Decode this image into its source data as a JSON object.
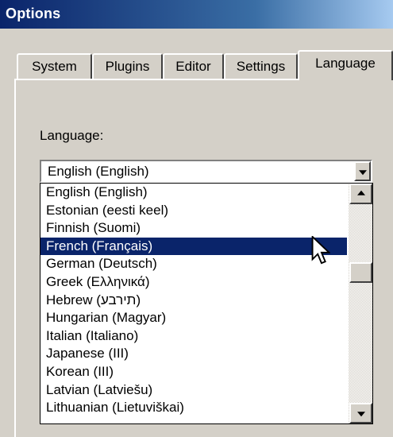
{
  "window": {
    "title": "Options"
  },
  "tabs": [
    {
      "label": "System",
      "active": false
    },
    {
      "label": "Plugins",
      "active": false
    },
    {
      "label": "Editor",
      "active": false
    },
    {
      "label": "Settings",
      "active": false
    },
    {
      "label": "Language",
      "active": true
    }
  ],
  "language": {
    "label": "Language:",
    "selected_value": "English (English)",
    "options": [
      "English (English)",
      "Estonian (eesti keel)",
      "Finnish (Suomi)",
      "French (Français)",
      "German (Deutsch)",
      "Greek  (Ελληνικά)",
      "Hebrew (תירבע)",
      "Hungarian (Magyar)",
      "Italian (Italiano)",
      "Japanese (III)",
      "Korean (III)",
      "Latvian (Latviešu)",
      "Lithuanian (Lietuviškai)"
    ],
    "highlighted_index": 3
  },
  "colors": {
    "title_bar": "#0a246a",
    "highlight": "#0a246a",
    "face": "#d4d0c8"
  },
  "icons": {
    "combo_arrow": "chevron-down-icon",
    "scroll_up": "arrow-up-icon",
    "scroll_down": "arrow-down-icon",
    "cursor": "mouse-pointer-icon"
  }
}
